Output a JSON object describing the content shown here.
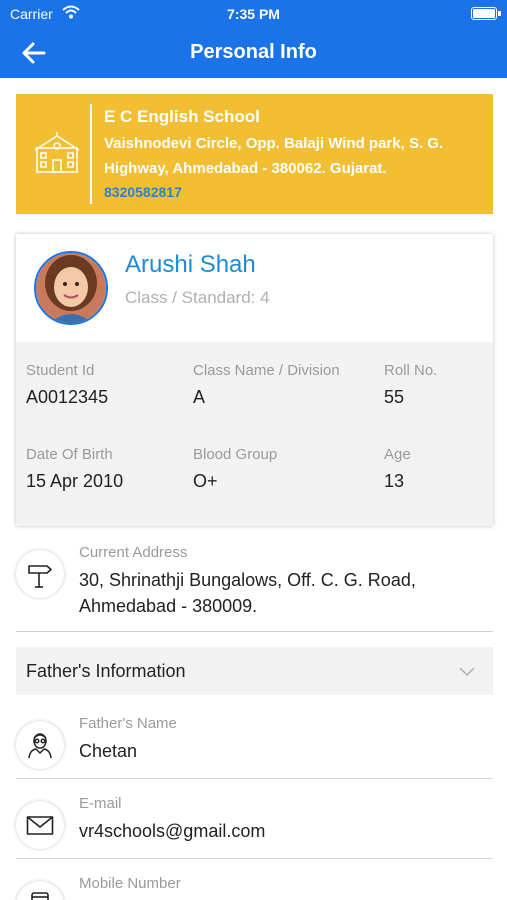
{
  "status_bar": {
    "carrier": "Carrier",
    "time": "7:35 PM"
  },
  "nav": {
    "title": "Personal Info",
    "back_icon": "back-arrow-icon"
  },
  "school": {
    "name": "E C English School",
    "address": "Vaishnodevi Circle, Opp. Balaji Wind park, S. G. Highway, Ahmedabad - 380062. Gujarat.",
    "phone": "8320582817",
    "icon": "school-building-icon",
    "banner_color": "#f2bf34"
  },
  "student": {
    "name": "Arushi Shah",
    "class_standard": "Class / Standard: 4",
    "details": [
      {
        "label": "Student Id",
        "value": "A0012345"
      },
      {
        "label": "Class Name / Division",
        "value": "A"
      },
      {
        "label": "Roll No.",
        "value": "55"
      },
      {
        "label": "Date Of Birth",
        "value": "15 Apr 2010"
      },
      {
        "label": "Blood Group",
        "value": "O+"
      },
      {
        "label": "Age",
        "value": "13"
      }
    ]
  },
  "address": {
    "label": "Current Address",
    "line1": "30, Shrinathji Bungalows, Off. C. G. Road,",
    "line2": "Ahmedabad - 380009.",
    "icon": "signpost-icon"
  },
  "father": {
    "section_title": "Father's Information",
    "name_label": "Father's Name",
    "name_value": "Chetan",
    "email_label": "E-mail",
    "email_value": "vr4schools@gmail.com",
    "mobile_label": "Mobile Number"
  },
  "colors": {
    "primary": "#1a73e8",
    "accent_text": "#1a8bd6",
    "label_gray": "#9a9a9a"
  }
}
